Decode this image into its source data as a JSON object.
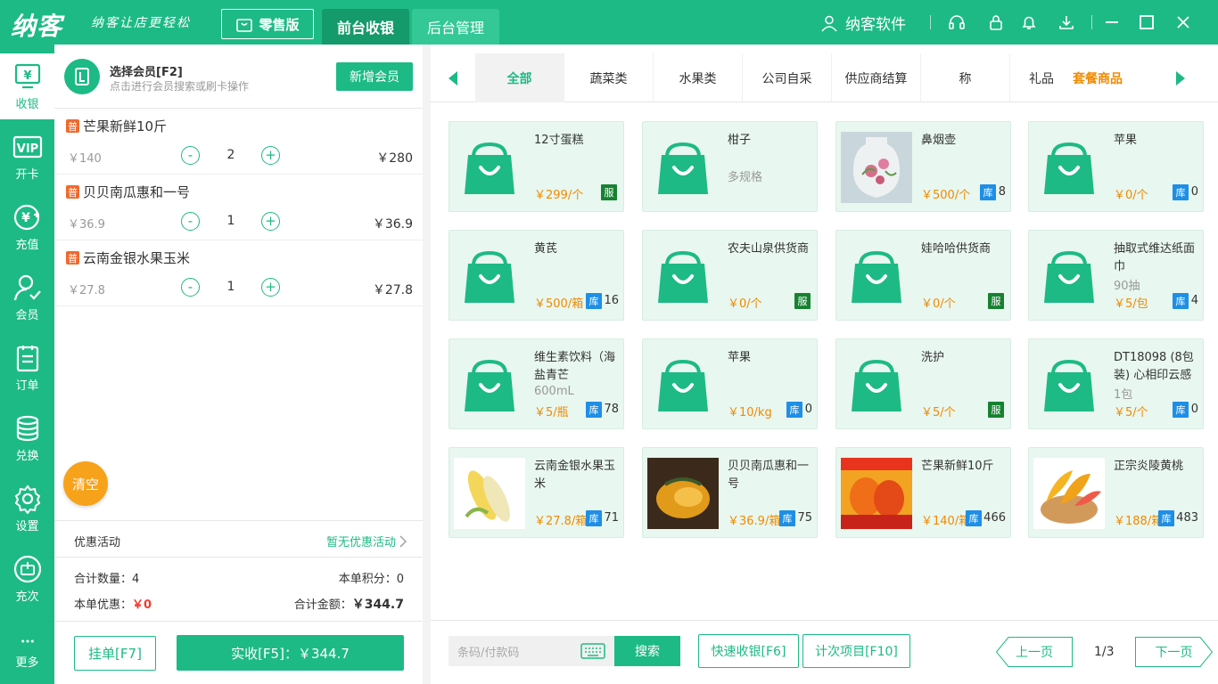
{
  "topbar": {
    "logo": "纳客",
    "slogan": "纳客让店更轻松",
    "edition": "零售版",
    "tabs": [
      "前台收银",
      "后台管理"
    ],
    "user": "纳客软件"
  },
  "sidebar": [
    {
      "label": "收银",
      "icon": "cashier-icon"
    },
    {
      "label": "开卡",
      "icon": "vip-card-icon"
    },
    {
      "label": "充值",
      "icon": "recharge-icon"
    },
    {
      "label": "会员",
      "icon": "member-icon"
    },
    {
      "label": "订单",
      "icon": "order-icon"
    },
    {
      "label": "兑换",
      "icon": "exchange-icon"
    },
    {
      "label": "设置",
      "icon": "settings-icon"
    },
    {
      "label": "充次",
      "icon": "recharge-times-icon"
    },
    {
      "label": "更多",
      "icon": "more-icon"
    }
  ],
  "member": {
    "title": "选择会员[F2]",
    "subtitle": "点击进行会员搜索或刷卡操作",
    "add_button": "新增会员"
  },
  "cart": [
    {
      "badge": "普",
      "name": "芒果新鲜10斤",
      "price": "￥140",
      "qty": "2",
      "total": "￥280"
    },
    {
      "badge": "普",
      "name": "贝贝南瓜惠和一号",
      "price": "￥36.9",
      "qty": "1",
      "total": "￥36.9"
    },
    {
      "badge": "普",
      "name": "云南金银水果玉米",
      "price": "￥27.8",
      "qty": "1",
      "total": "￥27.8"
    }
  ],
  "cart_controls": {
    "minus": "-",
    "plus": "+"
  },
  "clear_button": "清空",
  "promo": {
    "label": "优惠活动",
    "value": "暂无优惠活动"
  },
  "totals": {
    "count_label": "合计数量：",
    "count": "4",
    "points_label": "本单积分：",
    "points": "0",
    "discount_label": "本单优惠：",
    "discount": "￥0",
    "amount_label": "合计金额：",
    "amount": "￥344.7"
  },
  "actions": {
    "hold": "挂单[F7]",
    "pay": "实收[F5]：￥344.7"
  },
  "categories": [
    "全部",
    "蔬菜类",
    "水果类",
    "公司自采",
    "供应商结算",
    "称",
    "礼品",
    "套餐商品"
  ],
  "products": [
    {
      "name": "12寸蛋糕",
      "spec": "",
      "price": "￥299/个",
      "badge": "服",
      "stock": "",
      "image": "bag"
    },
    {
      "name": "柑子",
      "spec": "多规格",
      "price": "",
      "badge": "",
      "stock": "",
      "image": "bag"
    },
    {
      "name": "鼻烟壶",
      "spec": "",
      "price": "￥500/个",
      "badge": "库",
      "stock": "8",
      "image": "vase"
    },
    {
      "name": "苹果",
      "spec": "",
      "price": "￥0/个",
      "badge": "库",
      "stock": "0",
      "image": "bag"
    },
    {
      "name": "黄芪",
      "spec": "",
      "price": "￥500/箱",
      "badge": "库",
      "stock": "16",
      "image": "bag"
    },
    {
      "name": "农夫山泉供货商",
      "spec": "",
      "price": "￥0/个",
      "badge": "服",
      "stock": "",
      "image": "bag"
    },
    {
      "name": "娃哈哈供货商",
      "spec": "",
      "price": "￥0/个",
      "badge": "服",
      "stock": "",
      "image": "bag"
    },
    {
      "name": "抽取式维达纸面巾",
      "spec": "90抽",
      "price": "￥5/包",
      "badge": "库",
      "stock": "4",
      "image": "bag"
    },
    {
      "name": "维生素饮料（海盐青芒",
      "spec": "600mL",
      "price": "￥5/瓶",
      "badge": "库",
      "stock": "78",
      "image": "bag"
    },
    {
      "name": "苹果",
      "spec": "",
      "price": "￥10/kg",
      "badge": "库",
      "stock": "0",
      "image": "bag"
    },
    {
      "name": "洗护",
      "spec": "",
      "price": "￥5/个",
      "badge": "服",
      "stock": "",
      "image": "bag"
    },
    {
      "name": "DT18098 (8包装) 心相印云感",
      "spec": "1包",
      "price": "￥5/个",
      "badge": "库",
      "stock": "0",
      "image": "bag"
    },
    {
      "name": "云南金银水果玉米",
      "spec": "",
      "price": "￥27.8/箱",
      "badge": "库",
      "stock": "71",
      "image": "corn"
    },
    {
      "name": "贝贝南瓜惠和一号",
      "spec": "",
      "price": "￥36.9/箱",
      "badge": "库",
      "stock": "75",
      "image": "pumpkin"
    },
    {
      "name": "芒果新鲜10斤",
      "spec": "",
      "price": "￥140/箱",
      "badge": "库",
      "stock": "466",
      "image": "mango"
    },
    {
      "name": "正宗炎陵黄桃",
      "spec": "",
      "price": "￥188/箱",
      "badge": "库",
      "stock": "483",
      "image": "peach"
    }
  ],
  "bottom": {
    "barcode_placeholder": "条码/付款码",
    "search": "搜索",
    "quick_cash": "快速收银[F6]",
    "count_items": "计次项目[F10]",
    "prev": "上一页",
    "page": "1/3",
    "next": "下一页"
  },
  "colors": {
    "brand": "#1dba85",
    "orange": "#f08a00",
    "red": "#f03c2e"
  }
}
